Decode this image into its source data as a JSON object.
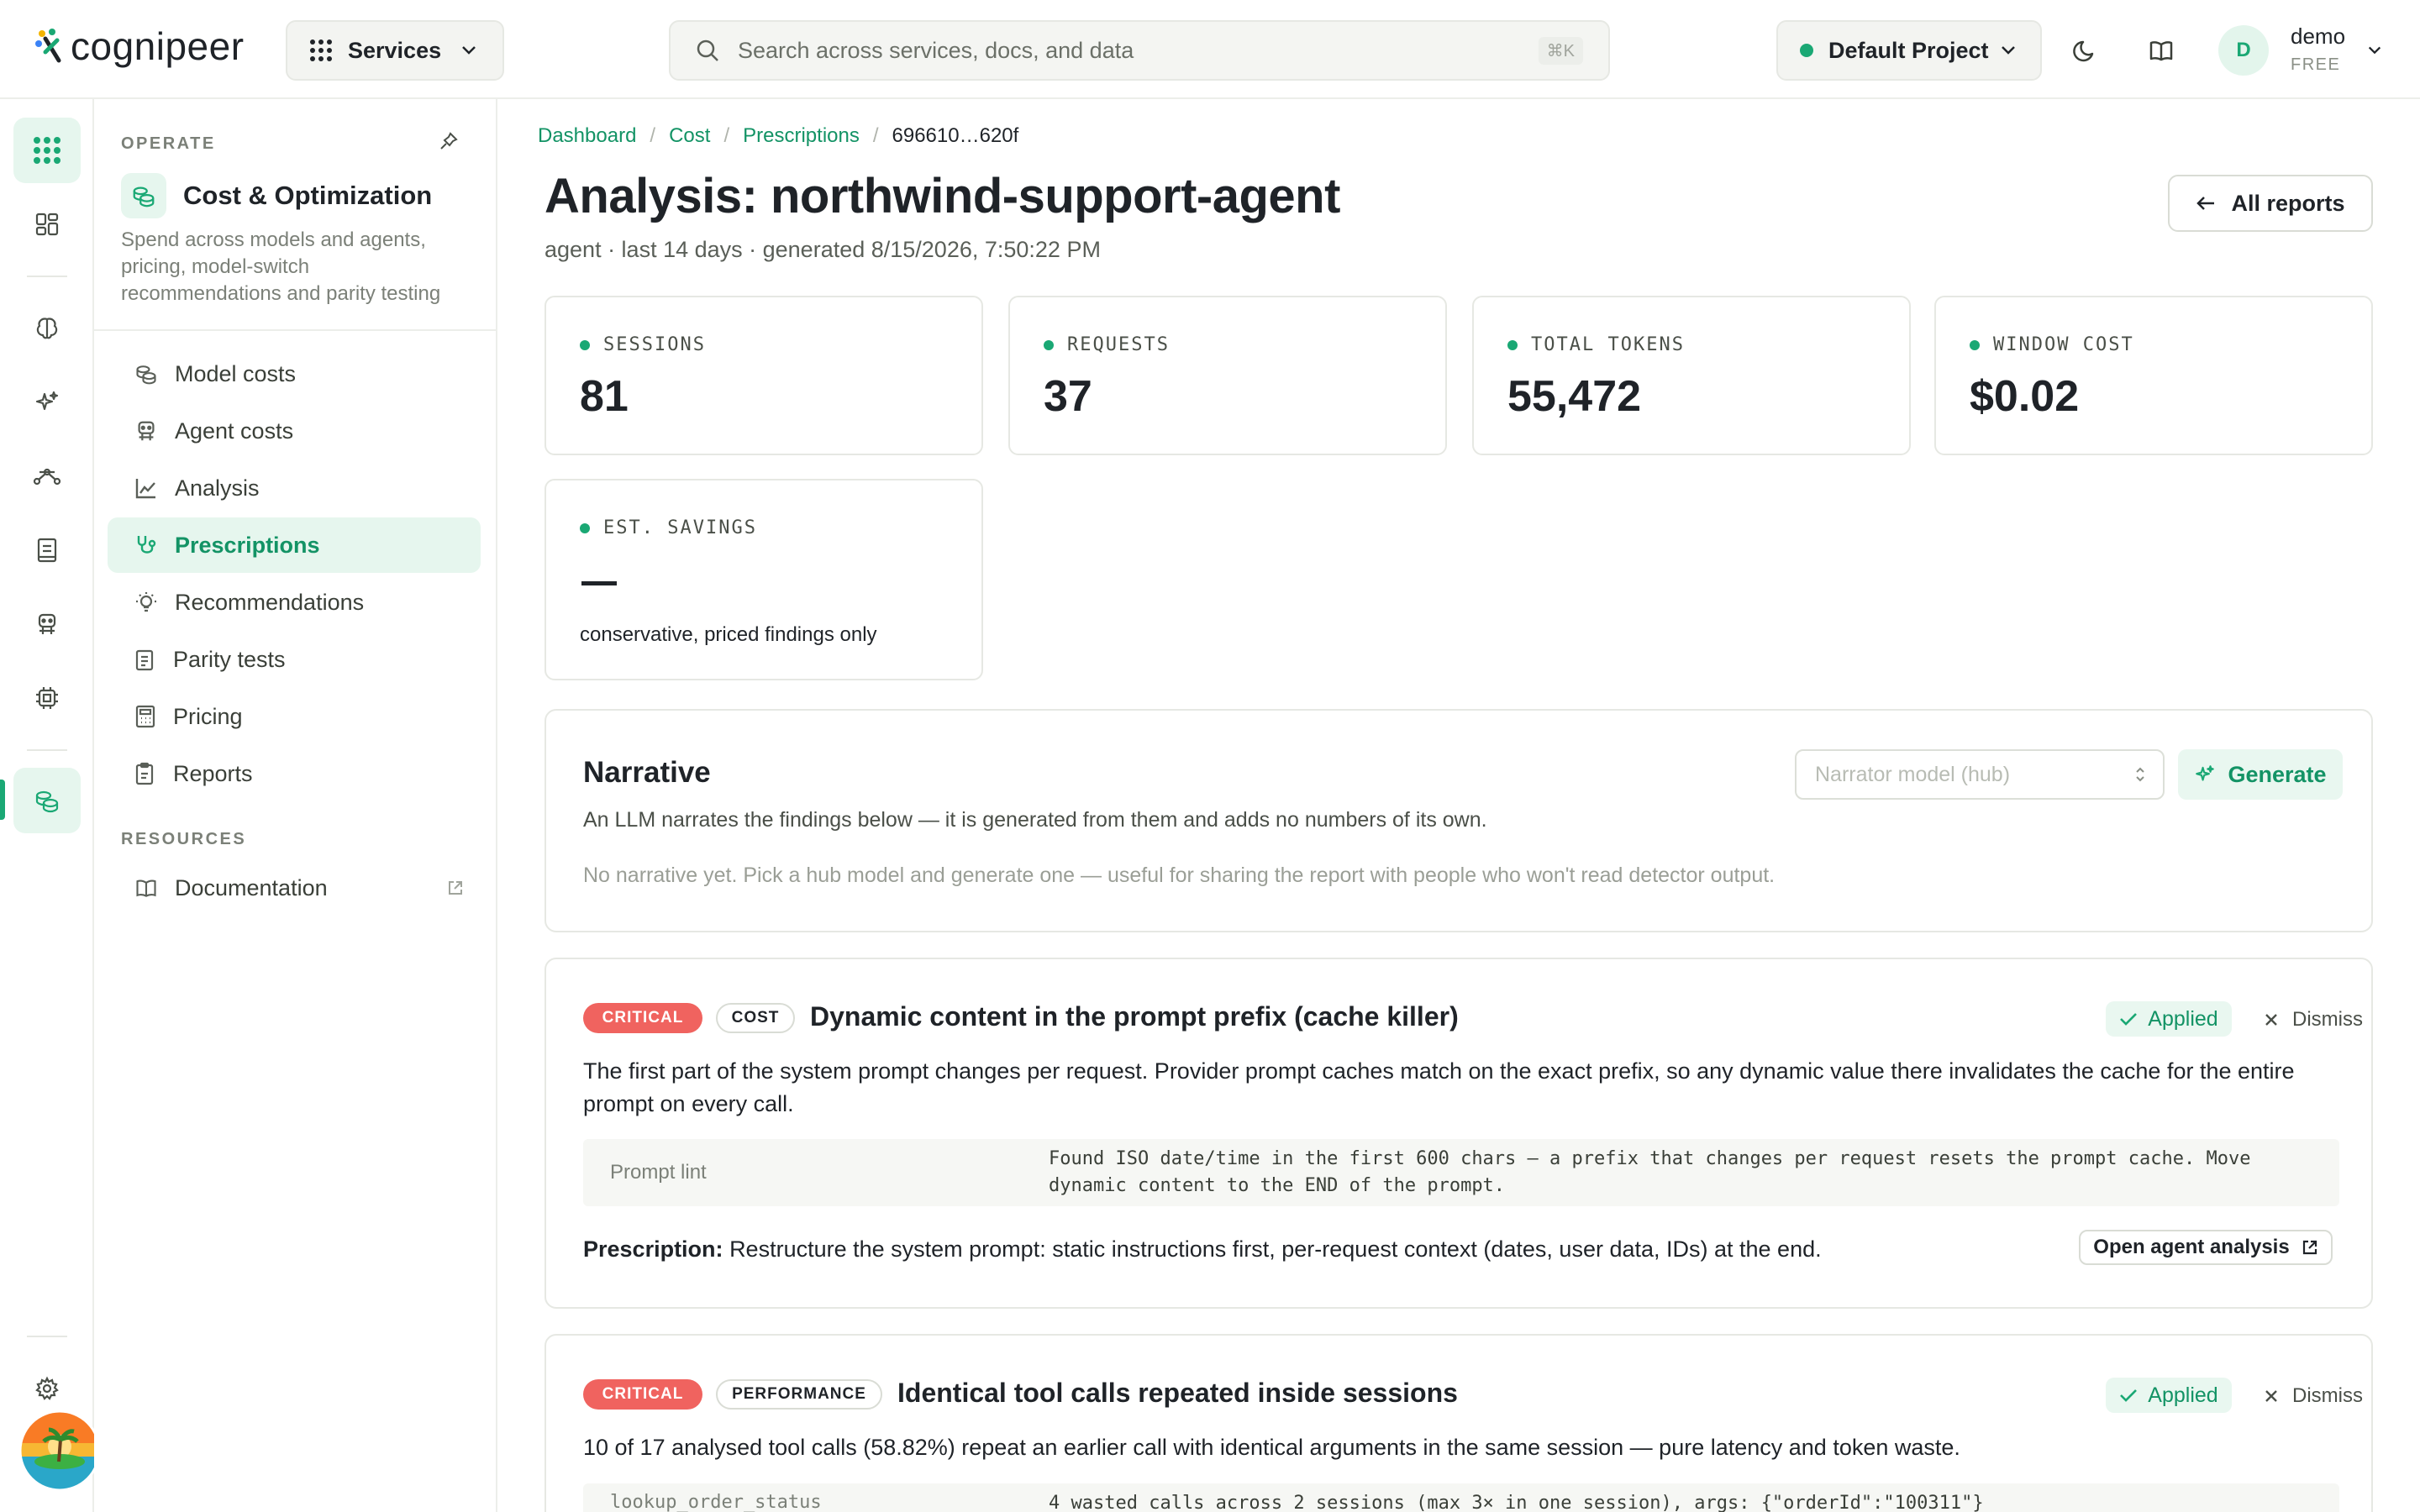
{
  "brand": {
    "logo_text": "cognipeer",
    "colors": {
      "accent": "#1aa874",
      "critical": "#f0635f"
    }
  },
  "topbar": {
    "services_label": "Services",
    "search_placeholder": "Search across services, docs, and data",
    "search_shortcut": "⌘K",
    "project_label": "Default Project",
    "icons": [
      "moon-icon",
      "book-icon"
    ],
    "user": {
      "initial": "D",
      "name": "demo",
      "plan": "FREE"
    }
  },
  "rail": {
    "icons": [
      "grid-icon",
      "dashboard-icon",
      "brain-icon",
      "sparkles-icon",
      "workflow-icon",
      "notebook-icon",
      "agent-icon",
      "chip-icon",
      "coins-icon",
      "settings-icon"
    ]
  },
  "sidebar": {
    "section_operate": "OPERATE",
    "title": "Cost & Optimization",
    "description": "Spend across models and agents, pricing, model-switch recommendations and parity testing",
    "items": [
      {
        "label": "Model costs",
        "icon": "coins-icon"
      },
      {
        "label": "Agent costs",
        "icon": "agent-icon"
      },
      {
        "label": "Analysis",
        "icon": "chart-icon"
      },
      {
        "label": "Prescriptions",
        "icon": "stethoscope-icon",
        "active": true
      },
      {
        "label": "Recommendations",
        "icon": "lightbulb-icon"
      },
      {
        "label": "Parity tests",
        "icon": "clipboard-icon"
      },
      {
        "label": "Pricing",
        "icon": "calculator-icon"
      },
      {
        "label": "Reports",
        "icon": "report-icon"
      }
    ],
    "section_resources": "RESOURCES",
    "resources": [
      {
        "label": "Documentation",
        "icon": "book-icon"
      }
    ]
  },
  "main": {
    "breadcrumb": {
      "items": [
        "Dashboard",
        "Cost",
        "Prescriptions"
      ],
      "current": "696610…620f",
      "separator": "/"
    },
    "title": "Analysis: northwind-support-agent",
    "subtitle": "agent · last 14 days · generated 8/15/2026, 7:50:22 PM",
    "all_reports_label": "All reports",
    "stats": [
      {
        "label": "SESSIONS",
        "value": "81"
      },
      {
        "label": "REQUESTS",
        "value": "37"
      },
      {
        "label": "TOTAL TOKENS",
        "value": "55,472"
      },
      {
        "label": "WINDOW COST",
        "value": "$0.02"
      }
    ],
    "savings": {
      "label": "EST. SAVINGS",
      "value": "—",
      "note": "conservative, priced findings only"
    },
    "narrative": {
      "title": "Narrative",
      "description": "An LLM narrates the findings below — it is generated from them and adds no numbers of its own.",
      "empty": "No narrative yet. Pick a hub model and generate one — useful for sharing the report with people who won't read detector output.",
      "select_placeholder": "Narrator model (hub)",
      "generate_label": "Generate"
    },
    "findings": [
      {
        "severity": "CRITICAL",
        "category": "COST",
        "title": "Dynamic content in the prompt prefix (cache killer)",
        "status": "Applied",
        "dismiss": "Dismiss",
        "body": "The first part of the system prompt changes per request. Provider prompt caches match on the exact prefix, so any dynamic value there invalidates the cache for the entire prompt on every call.",
        "evidence_source": "Prompt lint",
        "evidence_text": "Found ISO date/time in the first 600 chars — a prefix that changes per request resets the prompt cache. Move dynamic content to the END of the prompt.",
        "prescription_label": "Prescription:",
        "prescription": "Restructure the system prompt: static instructions first, per-request context (dates, user data, IDs) at the end.",
        "action_label": "Open agent analysis"
      },
      {
        "severity": "CRITICAL",
        "category": "PERFORMANCE",
        "title": "Identical tool calls repeated inside sessions",
        "status": "Applied",
        "dismiss": "Dismiss",
        "body": "10 of 17 analysed tool calls (58.82%) repeat an earlier call with identical arguments in the same session — pure latency and token waste.",
        "evidence_source": "lookup_order_status",
        "evidence_text": "4 wasted calls across 2 sessions (max 3× in one session), args: {\"orderId\":\"100311\"}"
      }
    ]
  }
}
